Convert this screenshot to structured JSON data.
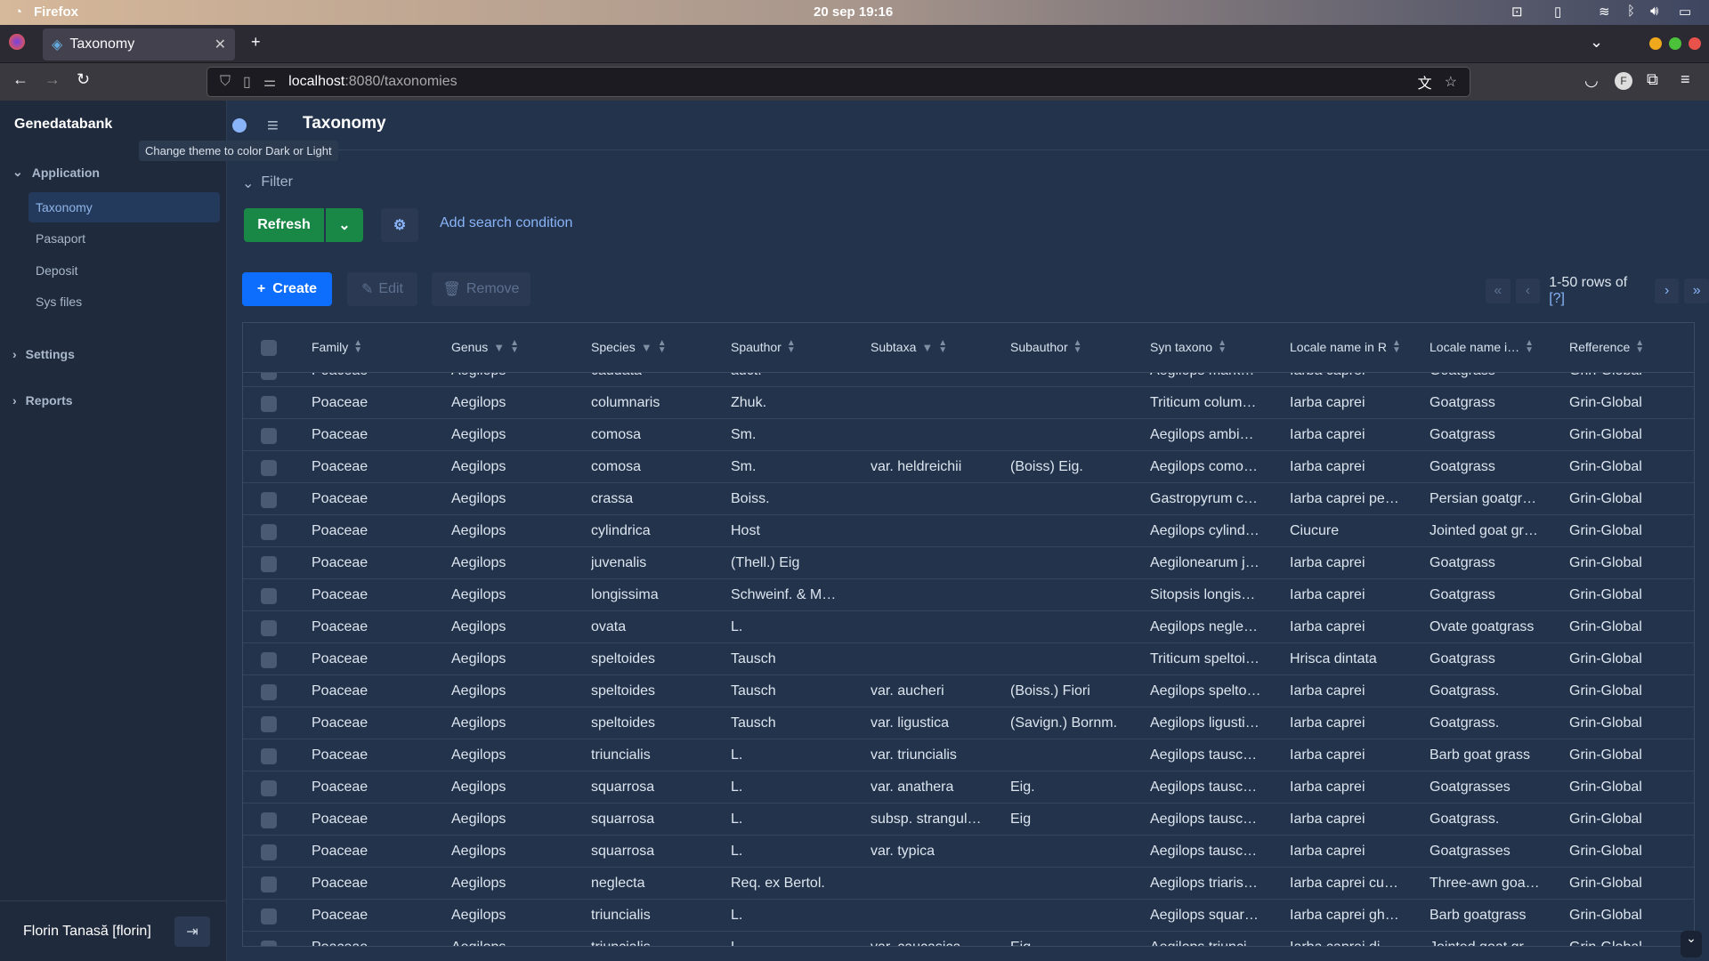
{
  "os": {
    "app": "Firefox",
    "clock": "20 sep  19:16"
  },
  "browser": {
    "tab_title": "Taxonomy",
    "url_host": "localhost",
    "url_rest": ":8080/taxonomies"
  },
  "sidebar": {
    "brand": "Genedatabank",
    "sections": [
      {
        "label": "Application",
        "expanded": true,
        "items": [
          "Taxonomy",
          "Pasaport",
          "Deposit",
          "Sys files"
        ]
      },
      {
        "label": "Settings"
      },
      {
        "label": "Reports"
      }
    ],
    "active": "Taxonomy",
    "user": "Florin Tanasă [florin]"
  },
  "header": {
    "title": "Taxonomy",
    "tooltip": "Change theme to color Dark or Light"
  },
  "filter": {
    "label": "Filter",
    "refresh": "Refresh",
    "add_condition": "Add search condition"
  },
  "toolbar": {
    "create": "Create",
    "edit": "Edit",
    "remove": "Remove",
    "pagination": "1-50 rows of ",
    "total": "[?]"
  },
  "colors": {
    "accent": "#0d6efd",
    "success": "#198754",
    "bg": "#22334b",
    "sidebar": "#1f2a3c"
  },
  "table": {
    "columns": [
      "Family",
      "Genus",
      "Species",
      "Spauthor",
      "Subtaxa",
      "Subauthor",
      "Syn taxono",
      "Locale name in R",
      "Locale name i…",
      "Refference"
    ],
    "filterable": [
      false,
      true,
      true,
      false,
      true,
      false,
      false,
      false,
      false,
      false
    ],
    "rows": [
      [
        "Poaceae",
        "Aegilops",
        "caudata",
        "auct.",
        "",
        "",
        "Aegilops mark…",
        "Iarba caprei",
        "Goatgrass",
        "Grin-Global"
      ],
      [
        "Poaceae",
        "Aegilops",
        "columnaris",
        "Zhuk.",
        "",
        "",
        "Triticum colum…",
        "Iarba caprei",
        "Goatgrass",
        "Grin-Global"
      ],
      [
        "Poaceae",
        "Aegilops",
        "comosa",
        "Sm.",
        "",
        "",
        "Aegilops ambi…",
        "Iarba caprei",
        "Goatgrass",
        "Grin-Global"
      ],
      [
        "Poaceae",
        "Aegilops",
        "comosa",
        "Sm.",
        "var. heldreichii",
        "(Boiss) Eig.",
        "Aegilops como…",
        "Iarba caprei",
        "Goatgrass",
        "Grin-Global"
      ],
      [
        "Poaceae",
        "Aegilops",
        "crassa",
        "Boiss.",
        "",
        "",
        "Gastropyrum c…",
        "Iarba caprei pe…",
        "Persian goatgr…",
        "Grin-Global"
      ],
      [
        "Poaceae",
        "Aegilops",
        "cylindrica",
        "Host",
        "",
        "",
        "Aegilops cylind…",
        "Ciucure",
        "Jointed goat gr…",
        "Grin-Global"
      ],
      [
        "Poaceae",
        "Aegilops",
        "juvenalis",
        "(Thell.) Eig",
        "",
        "",
        "Aegilonearum j…",
        "Iarba caprei",
        "Goatgrass",
        "Grin-Global"
      ],
      [
        "Poaceae",
        "Aegilops",
        "longissima",
        "Schweinf. & M…",
        "",
        "",
        "Sitopsis longis…",
        "Iarba caprei",
        "Goatgrass",
        "Grin-Global"
      ],
      [
        "Poaceae",
        "Aegilops",
        "ovata",
        "L.",
        "",
        "",
        "Aegilops negle…",
        "Iarba caprei",
        "Ovate goatgrass",
        "Grin-Global"
      ],
      [
        "Poaceae",
        "Aegilops",
        "speltoides",
        "Tausch",
        "",
        "",
        "Triticum speltoi…",
        "Hrisca dintata",
        "Goatgrass",
        "Grin-Global"
      ],
      [
        "Poaceae",
        "Aegilops",
        "speltoides",
        "Tausch",
        "var. aucheri",
        "(Boiss.) Fiori",
        "Aegilops spelto…",
        "Iarba caprei",
        "Goatgrass.",
        "Grin-Global"
      ],
      [
        "Poaceae",
        "Aegilops",
        "speltoides",
        "Tausch",
        "var. ligustica",
        "(Savign.) Bornm.",
        "Aegilops ligusti…",
        "Iarba caprei",
        "Goatgrass.",
        "Grin-Global"
      ],
      [
        "Poaceae",
        "Aegilops",
        "triuncialis",
        "L.",
        "var. triuncialis",
        "",
        "Aegilops tausc…",
        "Iarba caprei",
        "Barb goat grass",
        "Grin-Global"
      ],
      [
        "Poaceae",
        "Aegilops",
        "squarrosa",
        "L.",
        "var. anathera",
        "Eig.",
        "Aegilops tausc…",
        "Iarba caprei",
        "Goatgrasses",
        "Grin-Global"
      ],
      [
        "Poaceae",
        "Aegilops",
        "squarrosa",
        "L.",
        "subsp. strangul…",
        "Eig",
        "Aegilops tausc…",
        "Iarba caprei",
        "Goatgrass.",
        "Grin-Global"
      ],
      [
        "Poaceae",
        "Aegilops",
        "squarrosa",
        "L.",
        "var. typica",
        "",
        "Aegilops tausc…",
        "Iarba caprei",
        "Goatgrasses",
        "Grin-Global"
      ],
      [
        "Poaceae",
        "Aegilops",
        "neglecta",
        "Req. ex Bertol.",
        "",
        "",
        "Aegilops triaris…",
        "Iarba caprei cu…",
        "Three-awn goa…",
        "Grin-Global"
      ],
      [
        "Poaceae",
        "Aegilops",
        "triuncialis",
        "L.",
        "",
        "",
        "Aegilops squar…",
        "Iarba caprei gh…",
        "Barb goatgrass",
        "Grin-Global"
      ],
      [
        "Poaceae",
        "Aegilops",
        "triuncialis",
        "L.",
        "var. caucasica",
        "Eig.",
        "Aegilops triunci…",
        "Iarba caprei di…",
        "Jointed goat gr…",
        "Grin-Global"
      ]
    ]
  }
}
